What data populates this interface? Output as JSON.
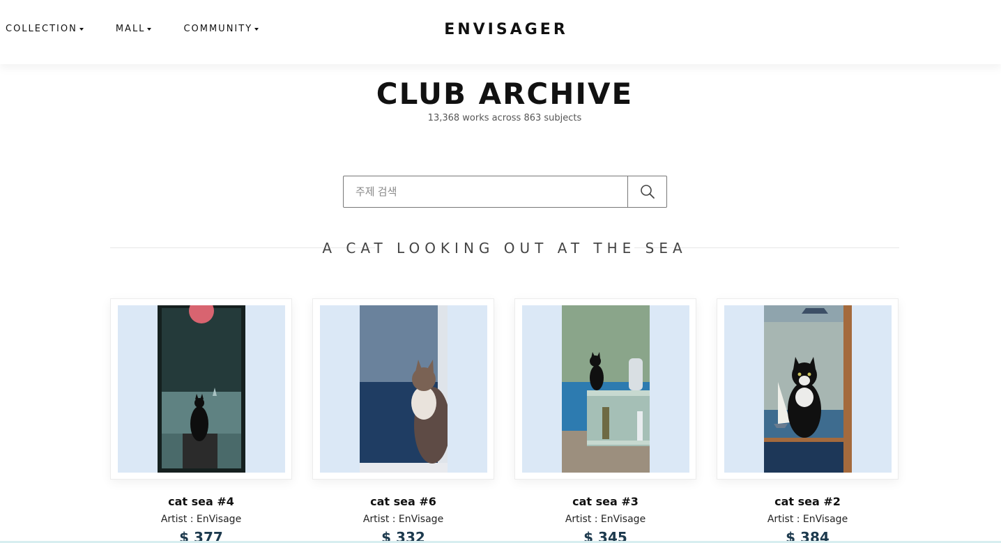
{
  "nav": {
    "items": [
      {
        "label": "COLLECTION"
      },
      {
        "label": "MALL"
      },
      {
        "label": "COMMUNITY"
      }
    ],
    "logo": "ENVISAGER"
  },
  "header": {
    "title": "CLUB ARCHIVE",
    "subtitle": "13,368 works across 863 subjects"
  },
  "search": {
    "placeholder": "주제 검색",
    "icon": "search-icon"
  },
  "section": {
    "theme": "A CAT LOOKING OUT AT THE SEA"
  },
  "cards": [
    {
      "name": "cat sea #4",
      "artist": "Artist : EnVisage",
      "price": "$ 377"
    },
    {
      "name": "cat sea #6",
      "artist": "Artist : EnVisage",
      "price": "$ 332"
    },
    {
      "name": "cat sea #3",
      "artist": "Artist : EnVisage",
      "price": "$ 345"
    },
    {
      "name": "cat sea #2",
      "artist": "Artist : EnVisage",
      "price": "$ 384"
    }
  ],
  "colors": {
    "card_background": "#dbe8f6",
    "price_text": "#1d3a4e"
  }
}
